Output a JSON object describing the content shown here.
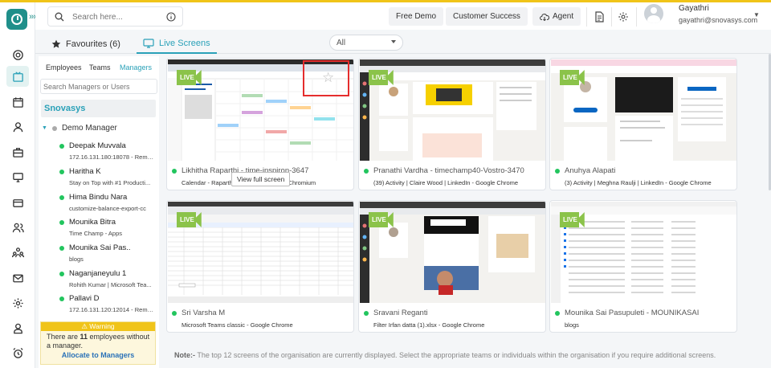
{
  "header": {
    "search_placeholder": "Search here...",
    "free_demo": "Free Demo",
    "customer_success": "Customer Success",
    "agent": "Agent",
    "user_name": "Gayathri",
    "user_email": "gayathri@snovasys.com"
  },
  "tabs": {
    "favourites": "Favourites (6)",
    "live_screens": "Live Screens",
    "filter_value": "All"
  },
  "panel": {
    "tab_employees": "Employees",
    "tab_teams": "Teams",
    "tab_managers": "Managers",
    "search_placeholder": "Search Managers or Users",
    "org_name": "Snovasys",
    "manager_name": "Demo Manager",
    "employees": [
      {
        "name": "Deepak Muvvala",
        "activity": "172.16.131.180:18078 - Remot..."
      },
      {
        "name": "Haritha K",
        "activity": "Stay on Top with #1 Producti..."
      },
      {
        "name": "Hima Bindu Nara",
        "activity": "customize-balance-export-cc"
      },
      {
        "name": "Mounika Bitra",
        "activity": "Time Champ - Apps"
      },
      {
        "name": "Mounika Sai Pas..",
        "activity": "blogs"
      },
      {
        "name": "Naganjaneyulu 1",
        "activity": "Rohith Kumar | Microsoft Tea..."
      },
      {
        "name": "Pallavi D",
        "activity": "172.16.131.120:12014 - Remot..."
      }
    ],
    "warning_title": "⚠ Warning",
    "warning_pre": "There are ",
    "warning_count": "11",
    "warning_post": " employees without a manager.",
    "warning_link": "Allocate to Managers"
  },
  "cards": [
    {
      "title": "Likhitha Raparthi - time-inspiron-3647",
      "activity": "Calendar - Raparthi Likhitha - Outlook - Chromium"
    },
    {
      "title": "Pranathi Vardha - timechamp40-Vostro-3470",
      "activity": "(39) Activity | Claire Wood | LinkedIn - Google Chrome"
    },
    {
      "title": "Anuhya Alapati",
      "activity": "(3) Activity | Meghna Raulji | LinkedIn - Google Chrome"
    },
    {
      "title": "Sri Varsha M",
      "activity": "Microsoft Teams classic - Google Chrome"
    },
    {
      "title": "Sravani Reganti",
      "activity": "Filter Irfan datta (1).xlsx - Google Chrome"
    },
    {
      "title": "Mounika Sai Pasupuleti - MOUNIKASAI",
      "activity": "blogs"
    }
  ],
  "live_label": "LIVE",
  "view_full_screen": "View full screen",
  "note_label": "Note:-",
  "note_text": " The top 12 screens of the organisation are currently displayed. Select the appropriate teams or individuals within the organisation if you require additional screens.",
  "colors": {
    "accent": "#2aa1b8",
    "live": "#8bc34a",
    "online": "#22c55e",
    "warning": "#f0c419"
  }
}
